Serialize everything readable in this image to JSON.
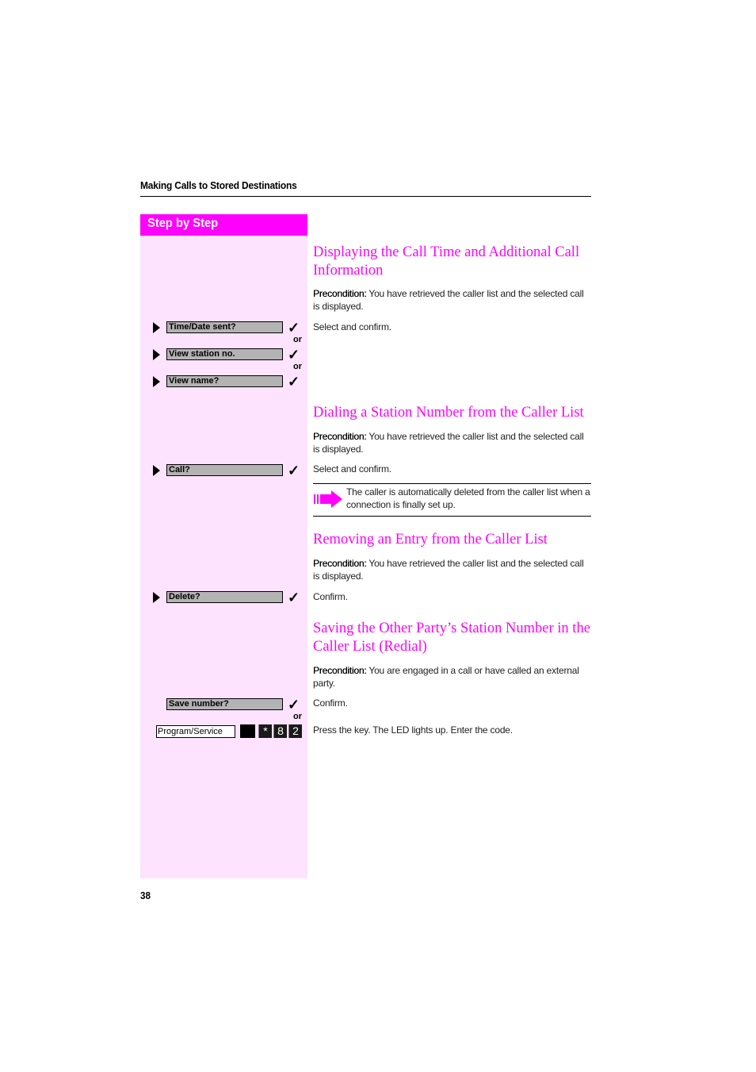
{
  "header": {
    "title": "Making Calls to Stored Destinations"
  },
  "sidebar": {
    "heading": "Step by Step"
  },
  "sections": [
    {
      "title": "Displaying the Call Time and Additional Call Information",
      "precondition_label": "Precondition:",
      "precondition_text": " You have retrieved the caller list and the selected call is displayed.",
      "instruction": "Select and confirm.",
      "steps": [
        {
          "display": "Time/Date sent?",
          "icon": "triangle-right-icon",
          "confirm": "checkmark-icon"
        },
        {
          "display": "View station no.",
          "icon": "triangle-right-icon",
          "confirm": "checkmark-icon"
        },
        {
          "display": "View name?",
          "icon": "triangle-right-icon",
          "confirm": "checkmark-icon"
        }
      ]
    },
    {
      "title": "Dialing a Station Number from the Caller List",
      "precondition_label": "Precondition:",
      "precondition_text": " You have retrieved the caller list and the selected call is displayed.",
      "instruction": "Select and confirm.",
      "steps": [
        {
          "display": "Call?",
          "icon": "triangle-right-icon",
          "confirm": "checkmark-icon"
        }
      ],
      "note": "The caller is automatically deleted from the caller list when a connection is finally set up.",
      "note_icon": "arrow-right-icon"
    },
    {
      "title": "Removing an Entry from the Caller List",
      "precondition_label": "Precondition:",
      "precondition_text": " You have retrieved the caller list and the selected call is displayed.",
      "instruction": "Confirm.",
      "steps": [
        {
          "display": "Delete?",
          "icon": "triangle-right-icon",
          "confirm": "checkmark-icon"
        }
      ]
    },
    {
      "title": "Saving the Other Party’s Station Number in the Caller List (Redial)",
      "precondition_label": "Precondition:",
      "precondition_text": " You are engaged in a call or have called an external party.",
      "instruction": "Confirm.",
      "instruction2": "Press the key. The LED lights up. Enter the code.",
      "steps": [
        {
          "display": "Save number?",
          "confirm": "checkmark-icon"
        }
      ],
      "key_label": "Program/Service",
      "code_keys": [
        "*",
        "8",
        "2"
      ]
    }
  ],
  "or_label": "or",
  "page_number": "38",
  "colors": {
    "accent": "#ff00ff",
    "sidebar_bg": "#fde3fd",
    "display_bg": "#b3b3b3"
  }
}
